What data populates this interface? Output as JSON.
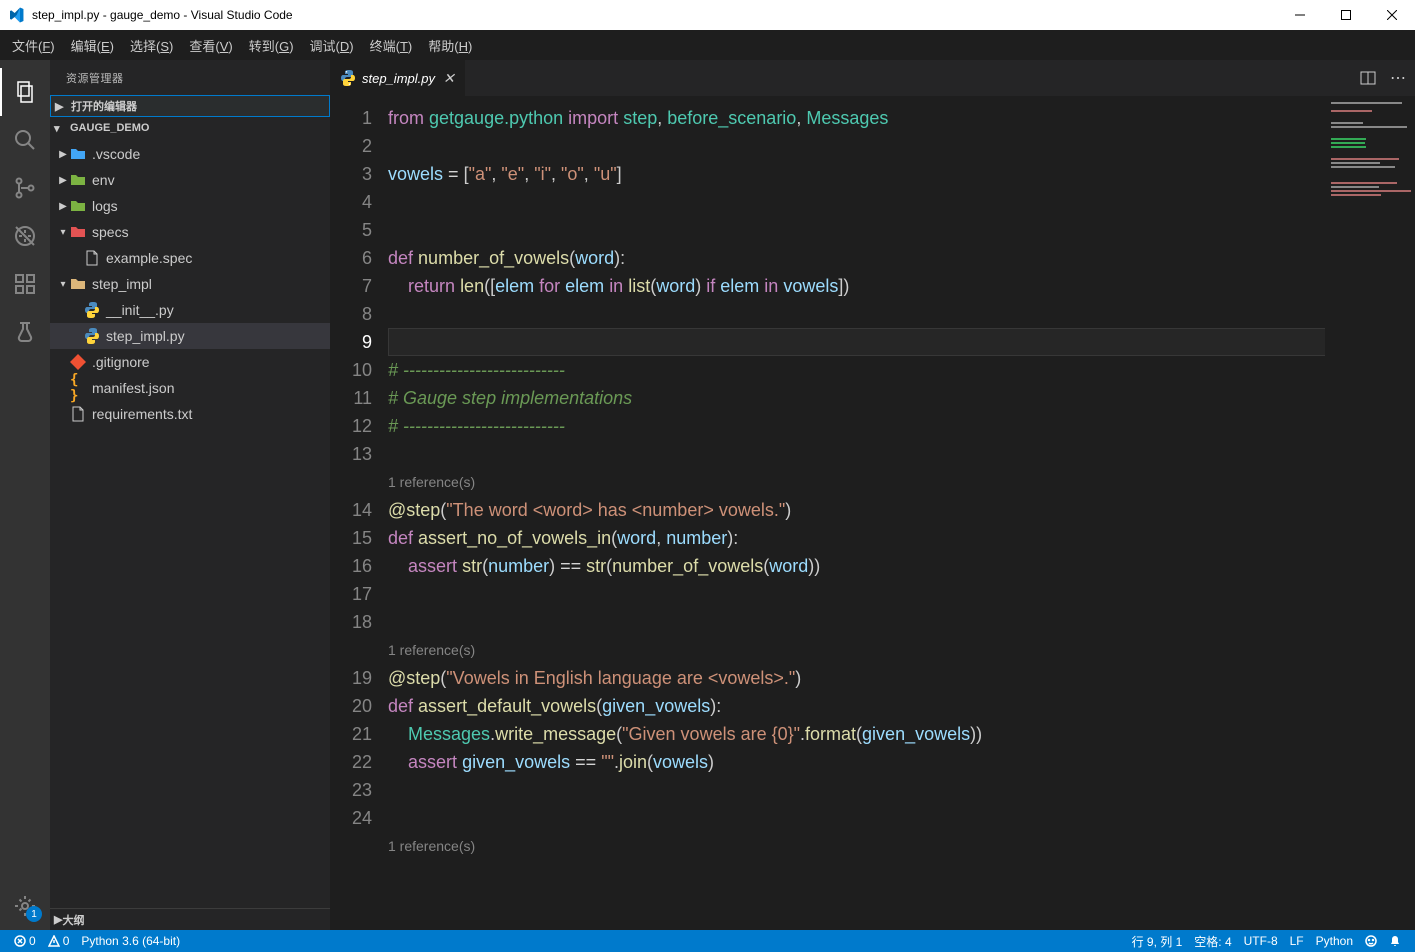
{
  "window_title": "step_impl.py - gauge_demo - Visual Studio Code",
  "menu": [
    {
      "label": "文件",
      "mn": "F"
    },
    {
      "label": "编辑",
      "mn": "E"
    },
    {
      "label": "选择",
      "mn": "S"
    },
    {
      "label": "查看",
      "mn": "V"
    },
    {
      "label": "转到",
      "mn": "G"
    },
    {
      "label": "调试",
      "mn": "D"
    },
    {
      "label": "终端",
      "mn": "T"
    },
    {
      "label": "帮助",
      "mn": "H"
    }
  ],
  "sidebar": {
    "title": "资源管理器",
    "sections": {
      "open_editors": "打开的编辑器",
      "project": "GAUGE_DEMO",
      "outline": "大纲"
    }
  },
  "tree": [
    {
      "ind": 0,
      "chev": "▶",
      "icon": "folder",
      "cls": "folder-b",
      "name": ".vscode"
    },
    {
      "ind": 0,
      "chev": "▶",
      "icon": "folder",
      "cls": "folder-g",
      "name": "env"
    },
    {
      "ind": 0,
      "chev": "▶",
      "icon": "folder",
      "cls": "folder-g",
      "name": "logs"
    },
    {
      "ind": 0,
      "chev": "▾",
      "icon": "folder",
      "cls": "folder-r",
      "name": "specs"
    },
    {
      "ind": 1,
      "chev": "",
      "icon": "file",
      "cls": "",
      "name": "example.spec"
    },
    {
      "ind": 0,
      "chev": "▾",
      "icon": "folder",
      "cls": "folder-y",
      "name": "step_impl"
    },
    {
      "ind": 1,
      "chev": "",
      "icon": "py",
      "cls": "",
      "name": "__init__.py"
    },
    {
      "ind": 1,
      "chev": "",
      "icon": "py",
      "cls": "",
      "name": "step_impl.py",
      "active": true
    },
    {
      "ind": 0,
      "chev": "",
      "icon": "git",
      "cls": "",
      "name": ".gitignore"
    },
    {
      "ind": 0,
      "chev": "",
      "icon": "json",
      "cls": "",
      "name": "manifest.json"
    },
    {
      "ind": 0,
      "chev": "",
      "icon": "file",
      "cls": "",
      "name": "requirements.txt"
    }
  ],
  "tab": {
    "name": "step_impl.py"
  },
  "lines": [
    {
      "n": 1,
      "h": "<span class='c-kw'>from</span> <span class='c-cls'>getgauge.python</span> <span class='c-kw'>import</span> <span class='c-cls'>step</span>, <span class='c-cls'>before_scenario</span>, <span class='c-cls'>Messages</span>"
    },
    {
      "n": 2,
      "h": ""
    },
    {
      "n": 3,
      "h": "<span class='c-par'>vowels</span> <span class='c-op'>=</span> [<span class='c-str'>\"a\"</span>, <span class='c-str'>\"e\"</span>, <span class='c-str'>\"i\"</span>, <span class='c-str'>\"o\"</span>, <span class='c-str'>\"u\"</span>]"
    },
    {
      "n": 4,
      "h": ""
    },
    {
      "n": 5,
      "h": ""
    },
    {
      "n": 6,
      "h": "<span class='c-kw'>def</span> <span class='c-fn'>number_of_vowels</span>(<span class='c-par'>word</span>):"
    },
    {
      "n": 7,
      "h": "    <span class='c-kw'>return</span> <span class='c-fn'>len</span>([<span class='c-par'>elem</span> <span class='c-kw'>for</span> <span class='c-par'>elem</span> <span class='c-kw'>in</span> <span class='c-fn'>list</span>(<span class='c-par'>word</span>) <span class='c-kw'>if</span> <span class='c-par'>elem</span> <span class='c-kw'>in</span> <span class='c-par'>vowels</span>])"
    },
    {
      "n": 8,
      "h": ""
    },
    {
      "n": 9,
      "h": "",
      "cur": true
    },
    {
      "n": 10,
      "h": "<span class='c-cmt'># ---------------------------</span>"
    },
    {
      "n": 11,
      "h": "<span class='c-cmt'># Gauge step implementations</span>"
    },
    {
      "n": 12,
      "h": "<span class='c-cmt'># ---------------------------</span>"
    },
    {
      "n": 13,
      "h": ""
    },
    {
      "codelens": "1 reference(s)"
    },
    {
      "n": 14,
      "h": "<span class='c-dec'>@step</span>(<span class='c-str'>\"The word &lt;word&gt; has &lt;number&gt; vowels.\"</span>)"
    },
    {
      "n": 15,
      "h": "<span class='c-kw'>def</span> <span class='c-fn'>assert_no_of_vowels_in</span>(<span class='c-par'>word</span>, <span class='c-par'>number</span>):"
    },
    {
      "n": 16,
      "h": "    <span class='c-kw'>assert</span> <span class='c-fn'>str</span>(<span class='c-par'>number</span>) <span class='c-op'>==</span> <span class='c-fn'>str</span>(<span class='c-fn'>number_of_vowels</span>(<span class='c-par'>word</span>))"
    },
    {
      "n": 17,
      "h": ""
    },
    {
      "n": 18,
      "h": ""
    },
    {
      "codelens": "1 reference(s)"
    },
    {
      "n": 19,
      "h": "<span class='c-dec'>@step</span>(<span class='c-str'>\"Vowels in English language are &lt;vowels&gt;.\"</span>)"
    },
    {
      "n": 20,
      "h": "<span class='c-kw'>def</span> <span class='c-fn'>assert_default_vowels</span>(<span class='c-par'>given_vowels</span>):"
    },
    {
      "n": 21,
      "h": "    <span class='c-cls'>Messages</span>.<span class='c-fn'>write_message</span>(<span class='c-str'>\"Given vowels are {0}\"</span>.<span class='c-fn'>format</span>(<span class='c-par'>given_vowels</span>))"
    },
    {
      "n": 22,
      "h": "    <span class='c-kw'>assert</span> <span class='c-par'>given_vowels</span> <span class='c-op'>==</span> <span class='c-str'>\"\"</span>.<span class='c-fn'>join</span>(<span class='c-par'>vowels</span>)"
    },
    {
      "n": 23,
      "h": ""
    },
    {
      "n": 24,
      "h": ""
    },
    {
      "codelens": "1 reference(s)"
    }
  ],
  "status": {
    "errors": "0",
    "warnings": "0",
    "interp": "Python 3.6 (64-bit)",
    "rowcol": "行 9, 列 1",
    "spaces": "空格: 4",
    "enc": "UTF-8",
    "eol": "LF",
    "lang": "Python"
  },
  "gear_badge": "1"
}
